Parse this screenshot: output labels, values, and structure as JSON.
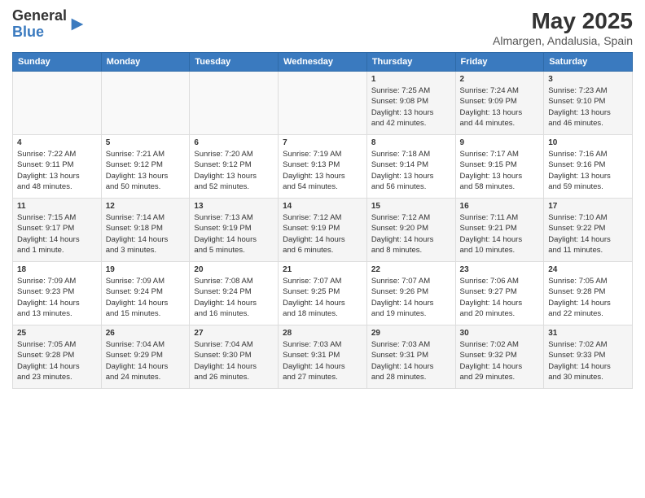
{
  "header": {
    "logo_general": "General",
    "logo_blue": "Blue",
    "title": "May 2025",
    "subtitle": "Almargen, Andalusia, Spain"
  },
  "days_of_week": [
    "Sunday",
    "Monday",
    "Tuesday",
    "Wednesday",
    "Thursday",
    "Friday",
    "Saturday"
  ],
  "weeks": [
    [
      {
        "day": "",
        "info": ""
      },
      {
        "day": "",
        "info": ""
      },
      {
        "day": "",
        "info": ""
      },
      {
        "day": "",
        "info": ""
      },
      {
        "day": "1",
        "info": "Sunrise: 7:25 AM\nSunset: 9:08 PM\nDaylight: 13 hours\nand 42 minutes."
      },
      {
        "day": "2",
        "info": "Sunrise: 7:24 AM\nSunset: 9:09 PM\nDaylight: 13 hours\nand 44 minutes."
      },
      {
        "day": "3",
        "info": "Sunrise: 7:23 AM\nSunset: 9:10 PM\nDaylight: 13 hours\nand 46 minutes."
      }
    ],
    [
      {
        "day": "4",
        "info": "Sunrise: 7:22 AM\nSunset: 9:11 PM\nDaylight: 13 hours\nand 48 minutes."
      },
      {
        "day": "5",
        "info": "Sunrise: 7:21 AM\nSunset: 9:12 PM\nDaylight: 13 hours\nand 50 minutes."
      },
      {
        "day": "6",
        "info": "Sunrise: 7:20 AM\nSunset: 9:12 PM\nDaylight: 13 hours\nand 52 minutes."
      },
      {
        "day": "7",
        "info": "Sunrise: 7:19 AM\nSunset: 9:13 PM\nDaylight: 13 hours\nand 54 minutes."
      },
      {
        "day": "8",
        "info": "Sunrise: 7:18 AM\nSunset: 9:14 PM\nDaylight: 13 hours\nand 56 minutes."
      },
      {
        "day": "9",
        "info": "Sunrise: 7:17 AM\nSunset: 9:15 PM\nDaylight: 13 hours\nand 58 minutes."
      },
      {
        "day": "10",
        "info": "Sunrise: 7:16 AM\nSunset: 9:16 PM\nDaylight: 13 hours\nand 59 minutes."
      }
    ],
    [
      {
        "day": "11",
        "info": "Sunrise: 7:15 AM\nSunset: 9:17 PM\nDaylight: 14 hours\nand 1 minute."
      },
      {
        "day": "12",
        "info": "Sunrise: 7:14 AM\nSunset: 9:18 PM\nDaylight: 14 hours\nand 3 minutes."
      },
      {
        "day": "13",
        "info": "Sunrise: 7:13 AM\nSunset: 9:19 PM\nDaylight: 14 hours\nand 5 minutes."
      },
      {
        "day": "14",
        "info": "Sunrise: 7:12 AM\nSunset: 9:19 PM\nDaylight: 14 hours\nand 6 minutes."
      },
      {
        "day": "15",
        "info": "Sunrise: 7:12 AM\nSunset: 9:20 PM\nDaylight: 14 hours\nand 8 minutes."
      },
      {
        "day": "16",
        "info": "Sunrise: 7:11 AM\nSunset: 9:21 PM\nDaylight: 14 hours\nand 10 minutes."
      },
      {
        "day": "17",
        "info": "Sunrise: 7:10 AM\nSunset: 9:22 PM\nDaylight: 14 hours\nand 11 minutes."
      }
    ],
    [
      {
        "day": "18",
        "info": "Sunrise: 7:09 AM\nSunset: 9:23 PM\nDaylight: 14 hours\nand 13 minutes."
      },
      {
        "day": "19",
        "info": "Sunrise: 7:09 AM\nSunset: 9:24 PM\nDaylight: 14 hours\nand 15 minutes."
      },
      {
        "day": "20",
        "info": "Sunrise: 7:08 AM\nSunset: 9:24 PM\nDaylight: 14 hours\nand 16 minutes."
      },
      {
        "day": "21",
        "info": "Sunrise: 7:07 AM\nSunset: 9:25 PM\nDaylight: 14 hours\nand 18 minutes."
      },
      {
        "day": "22",
        "info": "Sunrise: 7:07 AM\nSunset: 9:26 PM\nDaylight: 14 hours\nand 19 minutes."
      },
      {
        "day": "23",
        "info": "Sunrise: 7:06 AM\nSunset: 9:27 PM\nDaylight: 14 hours\nand 20 minutes."
      },
      {
        "day": "24",
        "info": "Sunrise: 7:05 AM\nSunset: 9:28 PM\nDaylight: 14 hours\nand 22 minutes."
      }
    ],
    [
      {
        "day": "25",
        "info": "Sunrise: 7:05 AM\nSunset: 9:28 PM\nDaylight: 14 hours\nand 23 minutes."
      },
      {
        "day": "26",
        "info": "Sunrise: 7:04 AM\nSunset: 9:29 PM\nDaylight: 14 hours\nand 24 minutes."
      },
      {
        "day": "27",
        "info": "Sunrise: 7:04 AM\nSunset: 9:30 PM\nDaylight: 14 hours\nand 26 minutes."
      },
      {
        "day": "28",
        "info": "Sunrise: 7:03 AM\nSunset: 9:31 PM\nDaylight: 14 hours\nand 27 minutes."
      },
      {
        "day": "29",
        "info": "Sunrise: 7:03 AM\nSunset: 9:31 PM\nDaylight: 14 hours\nand 28 minutes."
      },
      {
        "day": "30",
        "info": "Sunrise: 7:02 AM\nSunset: 9:32 PM\nDaylight: 14 hours\nand 29 minutes."
      },
      {
        "day": "31",
        "info": "Sunrise: 7:02 AM\nSunset: 9:33 PM\nDaylight: 14 hours\nand 30 minutes."
      }
    ]
  ]
}
